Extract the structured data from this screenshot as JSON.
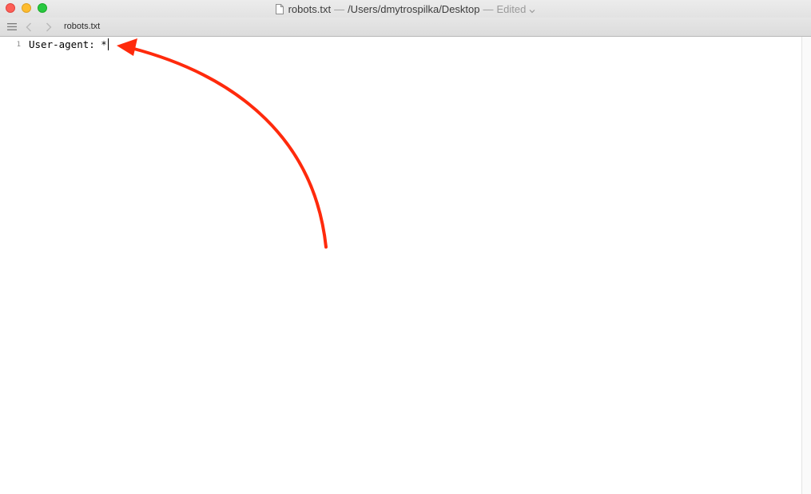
{
  "window": {
    "title_filename": "robots.txt",
    "title_separator": "—",
    "title_path": "/Users/dmytrospilka/Desktop",
    "title_status_separator": "—",
    "title_status": "Edited"
  },
  "jumpbar": {
    "file_label": "robots.txt"
  },
  "editor": {
    "lines": [
      {
        "number": "1",
        "text": "User-agent: *"
      }
    ]
  },
  "annotation": {
    "arrow_color": "#ff2a0c"
  }
}
